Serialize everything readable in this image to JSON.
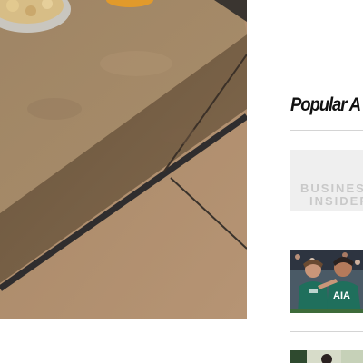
{
  "sidebar": {
    "title": "Popular A",
    "articles": [
      {
        "thumbnail": "business-insider-placeholder",
        "logo_line1": "BUSINES",
        "logo_line2": "INSIDER"
      },
      {
        "thumbnail": "football-players-photo"
      },
      {
        "thumbnail": "photo-partially-visible"
      }
    ]
  },
  "colors": {
    "concrete": "#a18562",
    "floor": "#ab8a68",
    "floor_seam": "#2f2d2e",
    "team_kit": "#1f6f5c",
    "divider": "#d4d4d4"
  }
}
